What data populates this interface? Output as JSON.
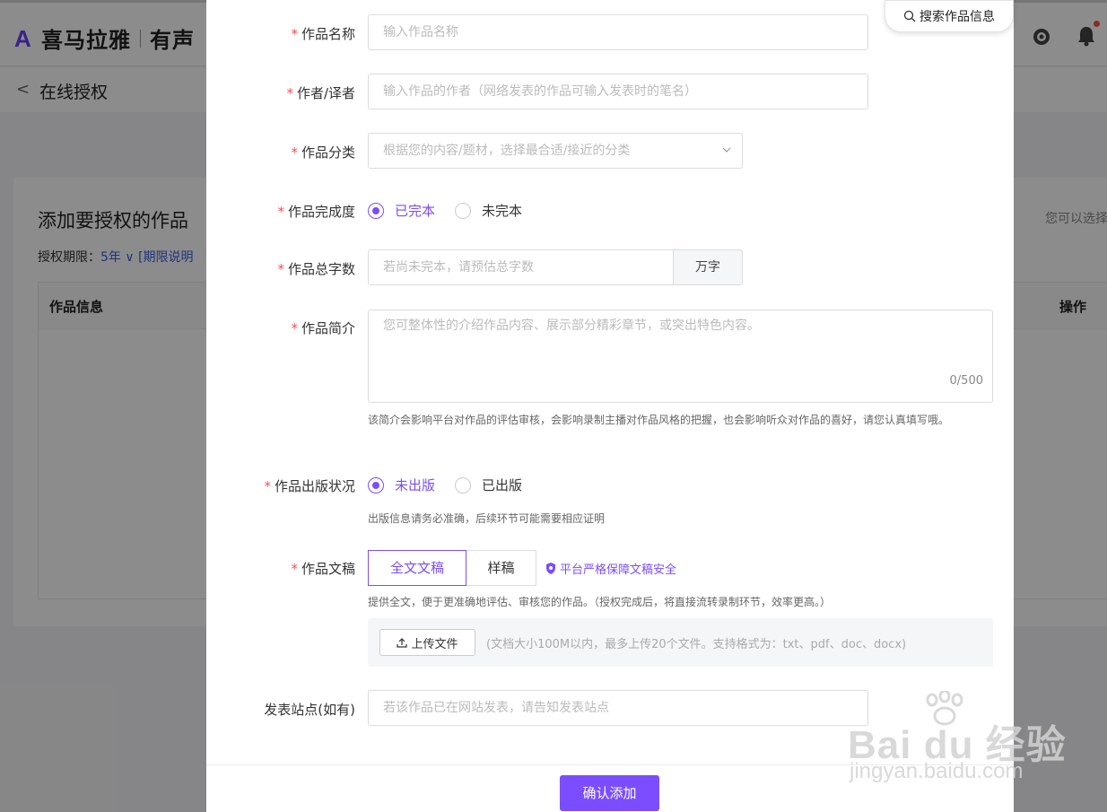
{
  "app": {
    "logo_text": "喜马拉雅",
    "logo_sub": "有声"
  },
  "subbar": {
    "back_icon": "chevron-left-icon",
    "title": "在线授权"
  },
  "card": {
    "title": "添加要授权的作品",
    "period_label": "授权期限：",
    "period_value": "5年",
    "period_link": "[期限说明",
    "hint": "您可以选择",
    "table_headers": {
      "info": "作品信息",
      "action": "操作"
    }
  },
  "search": {
    "label": "搜索作品信息",
    "icon": "search-icon"
  },
  "form": {
    "name": {
      "label": "作品名称",
      "placeholder": "输入作品名称"
    },
    "author": {
      "label": "作者/译者",
      "placeholder": "输入作品的作者（网络发表的作品可输入发表时的笔名）"
    },
    "category": {
      "label": "作品分类",
      "placeholder": "根据您的内容/题材，选择最合适/接近的分类"
    },
    "completion": {
      "label": "作品完成度",
      "options": [
        "已完本",
        "未完本"
      ],
      "selected": "已完本"
    },
    "word_count": {
      "label": "作品总字数",
      "placeholder": "若尚未完本，请预估总字数",
      "unit": "万字"
    },
    "intro": {
      "label": "作品简介",
      "placeholder": "您可整体性的介绍作品内容、展示部分精彩章节，或突出特色内容。",
      "counter": "0/500",
      "help": "该简介会影响平台对作品的评估审核，会影响录制主播对作品风格的把握，也会影响听众对作品的喜好，请您认真填写哦。"
    },
    "publish": {
      "label": "作品出版状况",
      "options": [
        "未出版",
        "已出版"
      ],
      "selected": "未出版",
      "help": "出版信息请务必准确，后续环节可能需要相应证明"
    },
    "manuscript": {
      "label": "作品文稿",
      "tabs": [
        "全文文稿",
        "样稿"
      ],
      "active_tab": "全文文稿",
      "secure_text": "平台严格保障文稿安全",
      "help": "提供全文，便于更准确地评估、审核您的作品。（授权完成后，将直接流转录制环节，效率更高。）",
      "upload_label": "上传文件",
      "upload_hint": "(文档大小100M以内，最多上传20个文件。支持格式为：txt、pdf、doc、docx)"
    },
    "site": {
      "label": "发表站点(如有)",
      "placeholder": "若该作品已在网站发表，请告知发表站点"
    },
    "required_mark": "*",
    "confirm_label": "确认添加"
  },
  "watermark": {
    "main": "Bai du 经验",
    "sub": "jingyan.baidu.com"
  },
  "colors": {
    "accent": "#7b4dff",
    "required": "#ff4d4f"
  }
}
